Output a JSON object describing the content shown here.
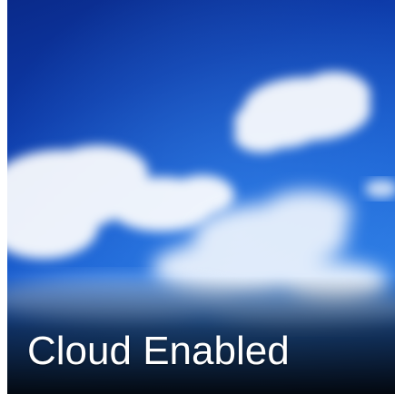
{
  "tile": {
    "caption": "Cloud Enabled"
  },
  "colors": {
    "sky_dark": "#0a2a8a",
    "sky_mid": "#1a5fd0",
    "sky_light": "#2a78e0",
    "cloud": "#ffffff",
    "caption_text": "#ffffff"
  }
}
